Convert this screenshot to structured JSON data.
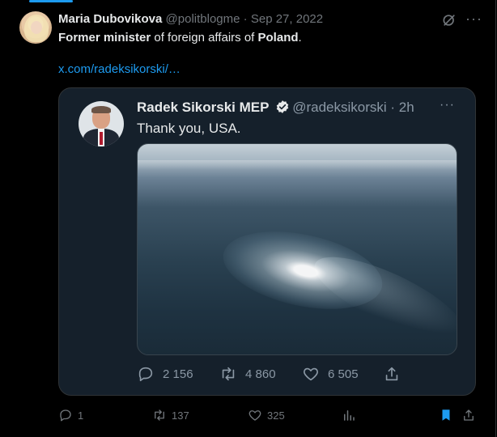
{
  "tweet": {
    "author_name": "Maria Dubovikova",
    "handle": "@politblogme",
    "separator": " · ",
    "date": "Sep 27, 2022",
    "text_bold1": "Former minister",
    "text_mid": " of foreign affairs of ",
    "text_bold2": "Poland",
    "text_end": ".",
    "link": "x.com/radeksikorski/…",
    "more_label": "···",
    "stats": {
      "replies": "1",
      "retweets": "137",
      "likes": "325"
    }
  },
  "quoted": {
    "author_name": "Radek Sikorski MEP",
    "handle": "@radeksikorski",
    "separator": " · ",
    "time": "2h",
    "text": "Thank you, USA.",
    "more_label": "···",
    "stats": {
      "replies": "2 156",
      "retweets": "4 860",
      "likes": "6 505"
    }
  },
  "colors": {
    "accent": "#1d9bf0",
    "background": "#000000",
    "quote_background": "#15202b"
  },
  "icons": {
    "grok": "grok-icon",
    "more": "more-icon",
    "verified": "verified-badge-icon",
    "reply": "reply-icon",
    "retweet": "retweet-icon",
    "like": "like-icon",
    "views": "views-icon",
    "bookmark": "bookmark-icon",
    "share": "share-icon"
  }
}
